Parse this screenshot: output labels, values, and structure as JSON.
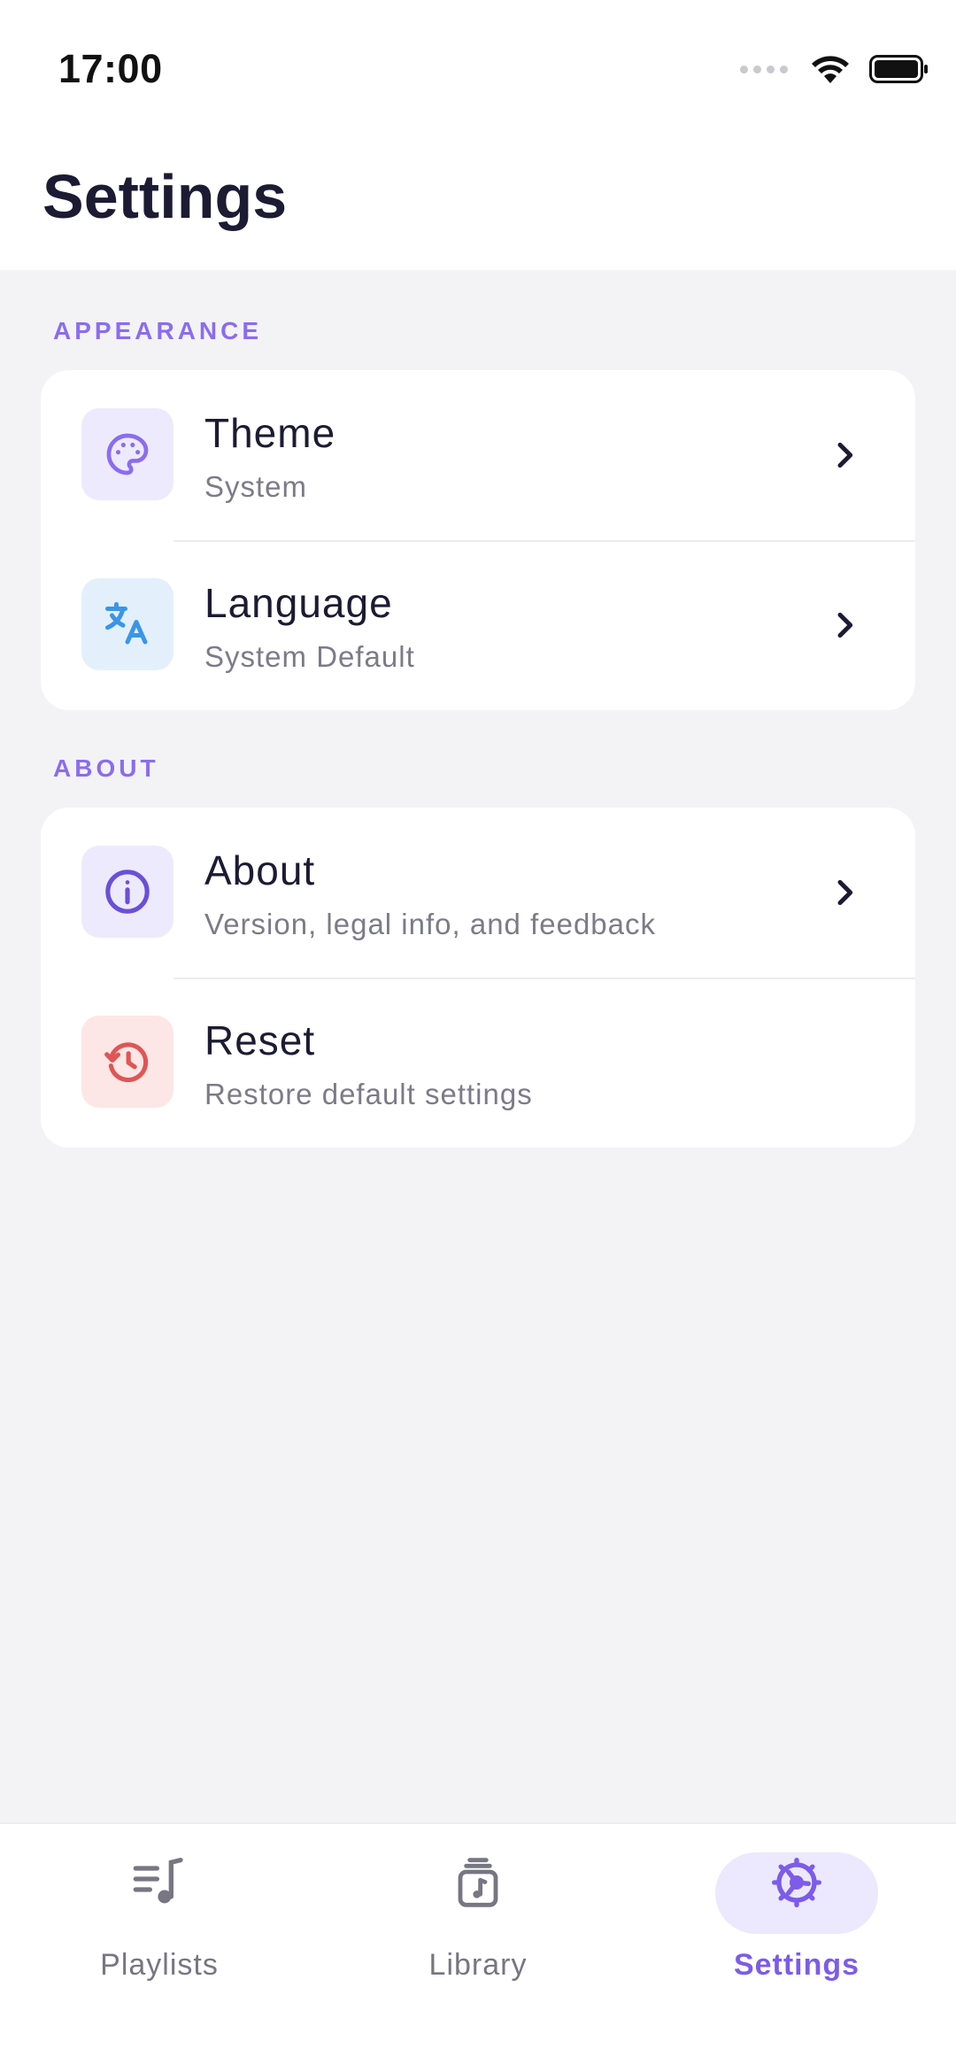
{
  "status_bar": {
    "time": "17:00"
  },
  "header": {
    "title": "Settings"
  },
  "sections": {
    "appearance": {
      "label": "APPEARANCE",
      "items": [
        {
          "title": "Theme",
          "subtitle": "System",
          "icon": "palette-icon",
          "icon_color": "#8b6cf0",
          "tile_color": "#eeeafd"
        },
        {
          "title": "Language",
          "subtitle": "System Default",
          "icon": "translate-icon",
          "icon_color": "#3b95e8",
          "tile_color": "#e3f0fc"
        }
      ]
    },
    "about": {
      "label": "ABOUT",
      "items": [
        {
          "title": "About",
          "subtitle": "Version, legal info, and feedback",
          "icon": "info-icon",
          "icon_color": "#6a4fd8",
          "tile_color": "#eeeafd"
        },
        {
          "title": "Reset",
          "subtitle": "Restore default settings",
          "icon": "reset-history-icon",
          "icon_color": "#e05555",
          "tile_color": "#fde6e6"
        }
      ]
    }
  },
  "bottom_nav": {
    "items": [
      {
        "label": "Playlists",
        "icon": "playlist-icon",
        "active": false
      },
      {
        "label": "Library",
        "icon": "library-icon",
        "active": false
      },
      {
        "label": "Settings",
        "icon": "settings-gear-icon",
        "active": true
      }
    ]
  },
  "colors": {
    "accent": "#8b6cf0",
    "background": "#f3f3f6",
    "card": "#ffffff",
    "title_text": "#1d1b33",
    "secondary_text": "#7c7b88"
  }
}
